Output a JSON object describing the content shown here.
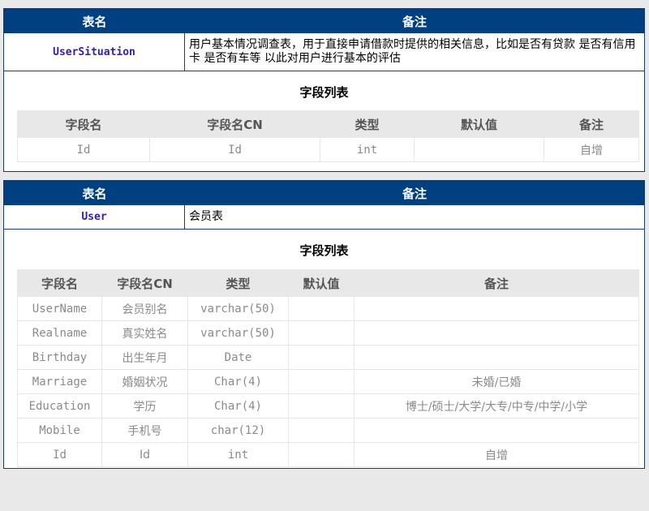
{
  "labels": {
    "table_name_header": "表名",
    "note_header": "备注",
    "field_list_title": "字段列表"
  },
  "colors": {
    "header_bg": "#003f80",
    "table_name_text": "#3a1aa8",
    "page_bg": "#e9e9e9"
  },
  "tables": [
    {
      "name": "UserSituation",
      "note": "用户基本情况调查表，用于直接申请借款时提供的相关信息，比如是否有贷款 是否有信用卡 是否有车等 以此对用户进行基本的评估",
      "columns": [
        "字段名",
        "字段名CN",
        "类型",
        "默认值",
        "备注"
      ],
      "rows": [
        {
          "field": "Id",
          "field_cn": "Id",
          "type": "int",
          "default": "",
          "note": "自增"
        }
      ]
    },
    {
      "name": "User",
      "note": "会员表",
      "columns": [
        "字段名",
        "字段名CN",
        "类型",
        "默认值",
        "备注"
      ],
      "rows": [
        {
          "field": "UserName",
          "field_cn": "会员别名",
          "type": "varchar(50)",
          "default": "",
          "note": ""
        },
        {
          "field": "Realname",
          "field_cn": "真实姓名",
          "type": "varchar(50)",
          "default": "",
          "note": ""
        },
        {
          "field": "Birthday",
          "field_cn": "出生年月",
          "type": "Date",
          "default": "",
          "note": ""
        },
        {
          "field": "Marriage",
          "field_cn": "婚姻状况",
          "type": "Char(4)",
          "default": "",
          "note": "未婚/已婚"
        },
        {
          "field": "Education",
          "field_cn": "学历",
          "type": "Char(4)",
          "default": "",
          "note": "博士/硕士/大学/大专/中专/中学/小学"
        },
        {
          "field": "Mobile",
          "field_cn": "手机号",
          "type": "char(12)",
          "default": "",
          "note": ""
        },
        {
          "field": "Id",
          "field_cn": "Id",
          "type": "int",
          "default": "",
          "note": "自增"
        }
      ]
    }
  ]
}
